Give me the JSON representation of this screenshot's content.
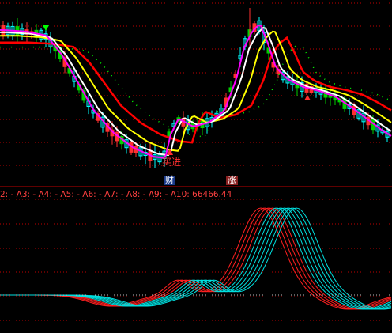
{
  "signals": {
    "buy_label": "买进",
    "badge_1": "财",
    "badge_2": "涨"
  },
  "indicator": {
    "text": "2: - A3: - A4: - A5: - A6: - A7: - A8: - A9: - A10: 66466.44"
  },
  "colors": {
    "background": "#000000",
    "grid": "#c00000",
    "up_candle": "#00ffff",
    "down_candle": "#ff3030",
    "ma_red": "#ff0000",
    "ma_yellow": "#ffff00",
    "ma_white": "#ffffff",
    "ma_magenta": "#ff00ff",
    "ma_dotted": "#00ff00",
    "osc_warm": "#ff2020",
    "osc_cool": "#00e0e0"
  }
}
